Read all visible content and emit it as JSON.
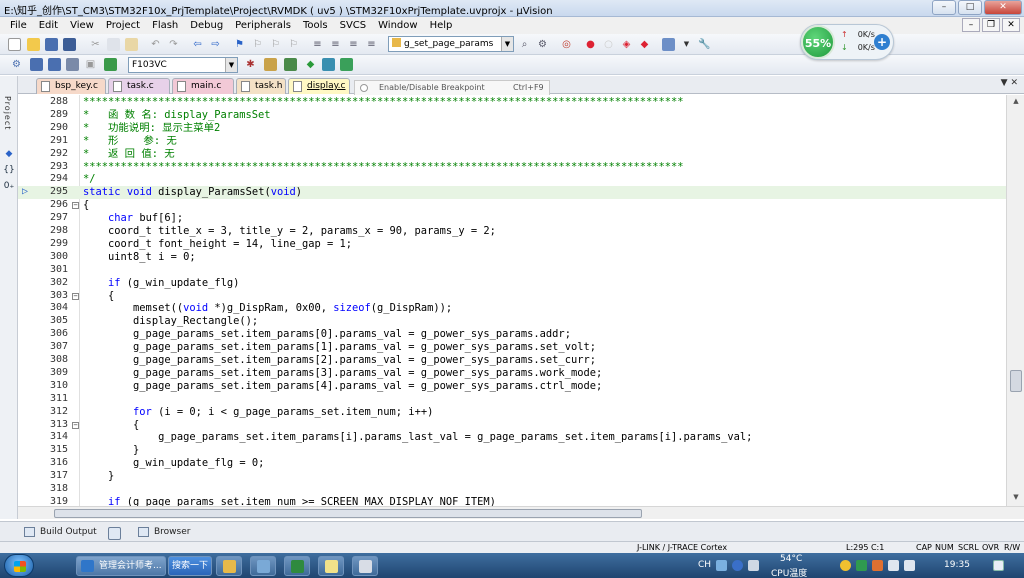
{
  "window": {
    "title": "E:\\知乎_创作\\ST_CM3\\STM32F10x_PrjTemplate\\Project\\RVMDK ( uv5 ) \\STM32F10xPrjTemplate.uvprojx - µVision",
    "minimize": "–",
    "maximize": "□",
    "close": "✕"
  },
  "menu": {
    "items": [
      "File",
      "Edit",
      "View",
      "Project",
      "Flash",
      "Debug",
      "Peripherals",
      "Tools",
      "SVCS",
      "Window",
      "Help"
    ],
    "mdi_min": "–",
    "mdi_restore": "❐",
    "mdi_close": "✕"
  },
  "toolbar": {
    "function_combo": "g_set_page_params",
    "target_combo": "F103VC"
  },
  "network": {
    "percent": "55%",
    "up": "0K/s",
    "down": "0K/s",
    "plus": "+"
  },
  "project_strip": {
    "label": "Project",
    "icons": [
      "◆",
      "{}",
      "0₊"
    ]
  },
  "tabs": [
    {
      "label": "bsp_key.c"
    },
    {
      "label": "task.c"
    },
    {
      "label": "main.c"
    },
    {
      "label": "task.h"
    },
    {
      "label": "display.c"
    }
  ],
  "breakpoint_tip": {
    "label": "Enable/Disable Breakpoint",
    "shortcut": "Ctrl+F9"
  },
  "editor": {
    "lines": [
      {
        "n": "288",
        "t": "************************************************************************************************"
      },
      {
        "n": "289",
        "t": "*   函 数 名: display_ParamsSet"
      },
      {
        "n": "290",
        "t": "*   功能说明: 显示主菜单2"
      },
      {
        "n": "291",
        "t": "*   形    参: 无"
      },
      {
        "n": "292",
        "t": "*   返 回 值: 无"
      },
      {
        "n": "293",
        "t": "************************************************************************************************"
      },
      {
        "n": "294",
        "t": "*/"
      },
      {
        "n": "295",
        "t": "static void display_ParamsSet(void)"
      },
      {
        "n": "296",
        "t": "{"
      },
      {
        "n": "297",
        "t": "    char buf[6];"
      },
      {
        "n": "298",
        "t": "    coord_t title_x = 3, title_y = 2, params_x = 90, params_y = 2;"
      },
      {
        "n": "299",
        "t": "    coord_t font_height = 14, line_gap = 1;"
      },
      {
        "n": "300",
        "t": "    uint8_t i = 0;"
      },
      {
        "n": "301",
        "t": ""
      },
      {
        "n": "302",
        "t": "    if (g_win_update_flg)"
      },
      {
        "n": "303",
        "t": "    {"
      },
      {
        "n": "304",
        "t": "        memset((void *)g_DispRam, 0x00, sizeof(g_DispRam));"
      },
      {
        "n": "305",
        "t": "        display_Rectangle();"
      },
      {
        "n": "306",
        "t": "        g_page_params_set.item_params[0].params_val = g_power_sys_params.addr;"
      },
      {
        "n": "307",
        "t": "        g_page_params_set.item_params[1].params_val = g_power_sys_params.set_volt;"
      },
      {
        "n": "308",
        "t": "        g_page_params_set.item_params[2].params_val = g_power_sys_params.set_curr;"
      },
      {
        "n": "309",
        "t": "        g_page_params_set.item_params[3].params_val = g_power_sys_params.work_mode;"
      },
      {
        "n": "310",
        "t": "        g_page_params_set.item_params[4].params_val = g_power_sys_params.ctrl_mode;"
      },
      {
        "n": "311",
        "t": ""
      },
      {
        "n": "312",
        "t": "        for (i = 0; i < g_page_params_set.item_num; i++)"
      },
      {
        "n": "313",
        "t": "        {"
      },
      {
        "n": "314",
        "t": "            g_page_params_set.item_params[i].params_last_val = g_page_params_set.item_params[i].params_val;"
      },
      {
        "n": "315",
        "t": "        }"
      },
      {
        "n": "316",
        "t": "        g_win_update_flg = 0;"
      },
      {
        "n": "317",
        "t": "    }"
      },
      {
        "n": "318",
        "t": ""
      },
      {
        "n": "319",
        "t": "    if (g_page_params_set.item_num >= SCREEN_MAX_DISPLAY_NOF_ITEM)"
      }
    ]
  },
  "bottom_tabs": [
    "Build Output",
    "Browser"
  ],
  "status": {
    "debugger": "J-LINK / J-TRACE Cortex",
    "position": "L:295 C:1",
    "cap": "CAP",
    "num": "NUM",
    "scrl": "SCRL",
    "ovr": "OVR",
    "rw": "R/W"
  },
  "taskbar": {
    "task1": "管理会计师考...",
    "task2": "搜索一下",
    "lang": "CH",
    "temp": "54°C",
    "cpu": "CPU温度",
    "clock": "19:35"
  }
}
